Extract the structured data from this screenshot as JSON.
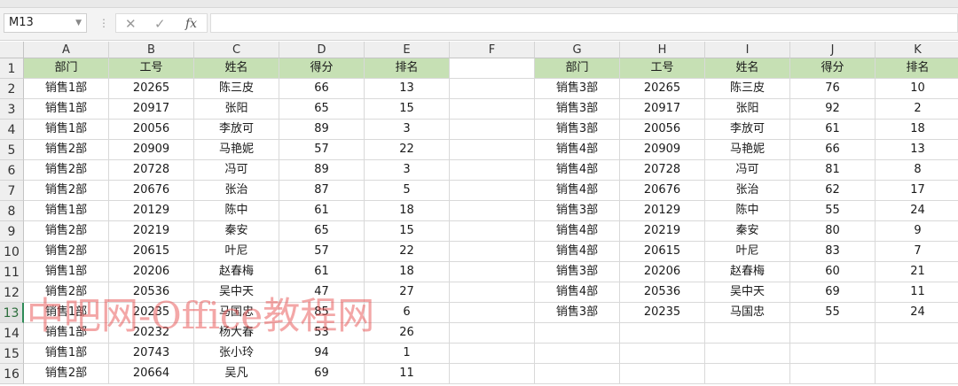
{
  "toolbar": {
    "name_box": "M13",
    "dropdown_icon": "chevron-down-icon",
    "more_icon": "vertical-dots-icon",
    "cancel_icon": "close-icon",
    "enter_icon": "check-icon",
    "function_label": "fx",
    "formula_value": ""
  },
  "grid": {
    "selected_row": 13,
    "header_fill": "#c6e0b4",
    "columns": [
      "A",
      "B",
      "C",
      "D",
      "E",
      "F",
      "G",
      "H",
      "I",
      "J",
      "K"
    ],
    "rows": [
      [
        "部门",
        "工号",
        "姓名",
        "得分",
        "排名",
        "",
        "部门",
        "工号",
        "姓名",
        "得分",
        "排名"
      ],
      [
        "销售1部",
        "20265",
        "陈三皮",
        "66",
        "13",
        "",
        "销售3部",
        "20265",
        "陈三皮",
        "76",
        "10"
      ],
      [
        "销售1部",
        "20917",
        "张阳",
        "65",
        "15",
        "",
        "销售3部",
        "20917",
        "张阳",
        "92",
        "2"
      ],
      [
        "销售1部",
        "20056",
        "李放可",
        "89",
        "3",
        "",
        "销售3部",
        "20056",
        "李放可",
        "61",
        "18"
      ],
      [
        "销售2部",
        "20909",
        "马艳妮",
        "57",
        "22",
        "",
        "销售4部",
        "20909",
        "马艳妮",
        "66",
        "13"
      ],
      [
        "销售2部",
        "20728",
        "冯可",
        "89",
        "3",
        "",
        "销售4部",
        "20728",
        "冯可",
        "81",
        "8"
      ],
      [
        "销售2部",
        "20676",
        "张治",
        "87",
        "5",
        "",
        "销售4部",
        "20676",
        "张治",
        "62",
        "17"
      ],
      [
        "销售1部",
        "20129",
        "陈中",
        "61",
        "18",
        "",
        "销售3部",
        "20129",
        "陈中",
        "55",
        "24"
      ],
      [
        "销售2部",
        "20219",
        "秦安",
        "65",
        "15",
        "",
        "销售4部",
        "20219",
        "秦安",
        "80",
        "9"
      ],
      [
        "销售2部",
        "20615",
        "叶尼",
        "57",
        "22",
        "",
        "销售4部",
        "20615",
        "叶尼",
        "83",
        "7"
      ],
      [
        "销售1部",
        "20206",
        "赵春梅",
        "61",
        "18",
        "",
        "销售3部",
        "20206",
        "赵春梅",
        "60",
        "21"
      ],
      [
        "销售2部",
        "20536",
        "吴中天",
        "47",
        "27",
        "",
        "销售4部",
        "20536",
        "吴中天",
        "69",
        "11"
      ],
      [
        "销售1部",
        "20235",
        "马国忠",
        "85",
        "6",
        "",
        "销售3部",
        "20235",
        "马国忠",
        "55",
        "24"
      ],
      [
        "销售1部",
        "20232",
        "杨大春",
        "53",
        "26",
        "",
        "",
        "",
        "",
        "",
        ""
      ],
      [
        "销售1部",
        "20743",
        "张小玲",
        "94",
        "1",
        "",
        "",
        "",
        "",
        "",
        ""
      ],
      [
        "销售2部",
        "20664",
        "吴凡",
        "69",
        "11",
        "",
        "",
        "",
        "",
        "",
        ""
      ]
    ]
  },
  "watermark": "中吧网-Office教程网"
}
